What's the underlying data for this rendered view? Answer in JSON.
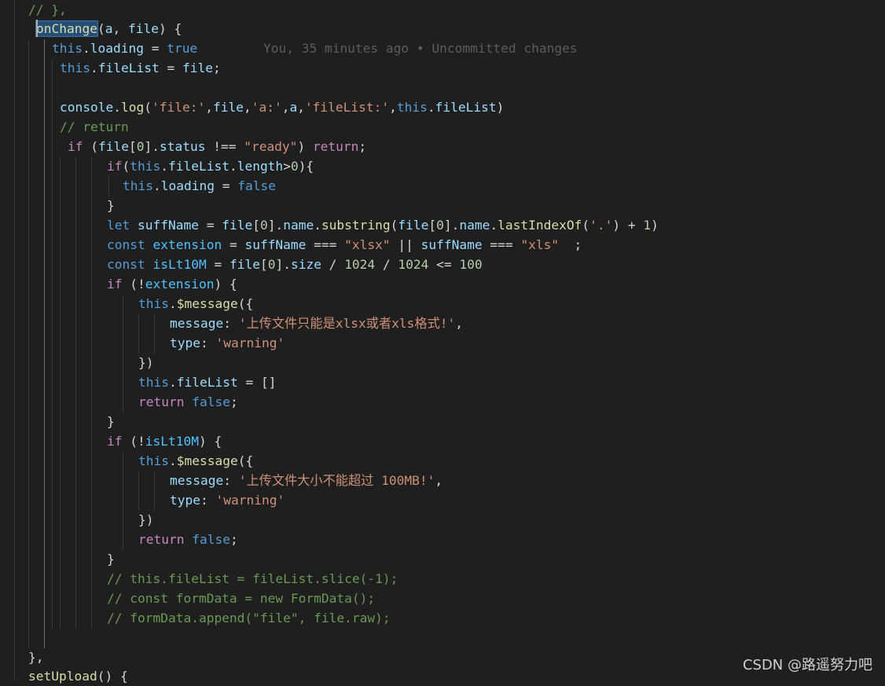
{
  "blame": "You, 35 minutes ago • Uncommitted changes",
  "watermark": "CSDN @路遥努力吧",
  "lines": [
    [
      [
        "cmt",
        "// },"
      ]
    ],
    [
      [
        "fn",
        "onChange"
      ],
      [
        "punc",
        "("
      ],
      [
        "var",
        "a"
      ],
      [
        "punc",
        ", "
      ],
      [
        "var",
        "file"
      ],
      [
        "punc",
        ") {"
      ]
    ],
    [
      [
        "kw",
        "this"
      ],
      [
        "punc",
        "."
      ],
      [
        "var",
        "loading"
      ],
      [
        "punc",
        " = "
      ],
      [
        "kw",
        "true"
      ]
    ],
    [
      [
        "kw",
        "this"
      ],
      [
        "punc",
        "."
      ],
      [
        "var",
        "fileList"
      ],
      [
        "punc",
        " = "
      ],
      [
        "var",
        "file"
      ],
      [
        "punc",
        ";"
      ]
    ],
    [],
    [
      [
        "var",
        "console"
      ],
      [
        "punc",
        "."
      ],
      [
        "fn",
        "log"
      ],
      [
        "punc",
        "("
      ],
      [
        "str",
        "'file:'"
      ],
      [
        "punc",
        ","
      ],
      [
        "var",
        "file"
      ],
      [
        "punc",
        ","
      ],
      [
        "str",
        "'a:'"
      ],
      [
        "punc",
        ","
      ],
      [
        "var",
        "a"
      ],
      [
        "punc",
        ","
      ],
      [
        "str",
        "'fileList:'"
      ],
      [
        "punc",
        ","
      ],
      [
        "kw",
        "this"
      ],
      [
        "punc",
        "."
      ],
      [
        "var",
        "fileList"
      ],
      [
        "punc",
        ")"
      ]
    ],
    [
      [
        "cmt",
        "// return"
      ]
    ],
    [
      [
        "ctl",
        "if"
      ],
      [
        "punc",
        " ("
      ],
      [
        "var",
        "file"
      ],
      [
        "punc",
        "["
      ],
      [
        "num",
        "0"
      ],
      [
        "punc",
        "]."
      ],
      [
        "var",
        "status"
      ],
      [
        "punc",
        " !== "
      ],
      [
        "str",
        "\"ready\""
      ],
      [
        "punc",
        ") "
      ],
      [
        "ctl",
        "return"
      ],
      [
        "punc",
        ";"
      ]
    ],
    [
      [
        "ctl",
        "if"
      ],
      [
        "punc",
        "("
      ],
      [
        "kw",
        "this"
      ],
      [
        "punc",
        "."
      ],
      [
        "var",
        "fileList"
      ],
      [
        "punc",
        "."
      ],
      [
        "var",
        "length"
      ],
      [
        "punc",
        ">"
      ],
      [
        "num",
        "0"
      ],
      [
        "punc",
        "){"
      ]
    ],
    [
      [
        "kw",
        "this"
      ],
      [
        "punc",
        "."
      ],
      [
        "var",
        "loading"
      ],
      [
        "punc",
        " = "
      ],
      [
        "kw",
        "false"
      ]
    ],
    [
      [
        "punc",
        "}"
      ]
    ],
    [
      [
        "kw",
        "let"
      ],
      [
        "punc",
        " "
      ],
      [
        "var",
        "suffName"
      ],
      [
        "punc",
        " = "
      ],
      [
        "var",
        "file"
      ],
      [
        "punc",
        "["
      ],
      [
        "num",
        "0"
      ],
      [
        "punc",
        "]."
      ],
      [
        "var",
        "name"
      ],
      [
        "punc",
        "."
      ],
      [
        "fn",
        "substring"
      ],
      [
        "punc",
        "("
      ],
      [
        "var",
        "file"
      ],
      [
        "punc",
        "["
      ],
      [
        "num",
        "0"
      ],
      [
        "punc",
        "]."
      ],
      [
        "var",
        "name"
      ],
      [
        "punc",
        "."
      ],
      [
        "fn",
        "lastIndexOf"
      ],
      [
        "punc",
        "("
      ],
      [
        "str",
        "'.'"
      ],
      [
        "punc",
        ") + "
      ],
      [
        "num",
        "1"
      ],
      [
        "punc",
        ")"
      ]
    ],
    [
      [
        "kw",
        "const"
      ],
      [
        "punc",
        " "
      ],
      [
        "cst",
        "extension"
      ],
      [
        "punc",
        " = "
      ],
      [
        "var",
        "suffName"
      ],
      [
        "punc",
        " === "
      ],
      [
        "str",
        "\"xlsx\""
      ],
      [
        "punc",
        " || "
      ],
      [
        "var",
        "suffName"
      ],
      [
        "punc",
        " === "
      ],
      [
        "str",
        "\"xls\""
      ],
      [
        "punc",
        "  ;"
      ]
    ],
    [
      [
        "kw",
        "const"
      ],
      [
        "punc",
        " "
      ],
      [
        "cst",
        "isLt10M"
      ],
      [
        "punc",
        " = "
      ],
      [
        "var",
        "file"
      ],
      [
        "punc",
        "["
      ],
      [
        "num",
        "0"
      ],
      [
        "punc",
        "]."
      ],
      [
        "var",
        "size"
      ],
      [
        "punc",
        " / "
      ],
      [
        "num",
        "1024"
      ],
      [
        "punc",
        " / "
      ],
      [
        "num",
        "1024"
      ],
      [
        "punc",
        " <= "
      ],
      [
        "num",
        "100"
      ]
    ],
    [
      [
        "ctl",
        "if"
      ],
      [
        "punc",
        " (!"
      ],
      [
        "cst",
        "extension"
      ],
      [
        "punc",
        ") {"
      ]
    ],
    [
      [
        "kw",
        "this"
      ],
      [
        "punc",
        "."
      ],
      [
        "fn",
        "$message"
      ],
      [
        "punc",
        "({"
      ]
    ],
    [
      [
        "var",
        "message"
      ],
      [
        "punc",
        ": "
      ],
      [
        "str",
        "'上传文件只能是xlsx或者xls格式!'"
      ],
      [
        "punc",
        ","
      ]
    ],
    [
      [
        "var",
        "type"
      ],
      [
        "punc",
        ": "
      ],
      [
        "str",
        "'warning'"
      ]
    ],
    [
      [
        "punc",
        "})"
      ]
    ],
    [
      [
        "kw",
        "this"
      ],
      [
        "punc",
        "."
      ],
      [
        "var",
        "fileList"
      ],
      [
        "punc",
        " = []"
      ]
    ],
    [
      [
        "ctl",
        "return"
      ],
      [
        "punc",
        " "
      ],
      [
        "kw",
        "false"
      ],
      [
        "punc",
        ";"
      ]
    ],
    [
      [
        "punc",
        "}"
      ]
    ],
    [
      [
        "ctl",
        "if"
      ],
      [
        "punc",
        " (!"
      ],
      [
        "cst",
        "isLt10M"
      ],
      [
        "punc",
        ") {"
      ]
    ],
    [
      [
        "kw",
        "this"
      ],
      [
        "punc",
        "."
      ],
      [
        "fn",
        "$message"
      ],
      [
        "punc",
        "({"
      ]
    ],
    [
      [
        "var",
        "message"
      ],
      [
        "punc",
        ": "
      ],
      [
        "str",
        "'上传文件大小不能超过 100MB!'"
      ],
      [
        "punc",
        ","
      ]
    ],
    [
      [
        "var",
        "type"
      ],
      [
        "punc",
        ": "
      ],
      [
        "str",
        "'warning'"
      ]
    ],
    [
      [
        "punc",
        "})"
      ]
    ],
    [
      [
        "ctl",
        "return"
      ],
      [
        "punc",
        " "
      ],
      [
        "kw",
        "false"
      ],
      [
        "punc",
        ";"
      ]
    ],
    [
      [
        "punc",
        "}"
      ]
    ],
    [
      [
        "cmt",
        "// this.fileList = fileList.slice(-1);"
      ]
    ],
    [
      [
        "cmt",
        "// const formData = new FormData();"
      ]
    ],
    [
      [
        "cmt",
        "// formData.append(\"file\", file.raw);"
      ]
    ],
    [],
    [],
    [
      [
        "punc",
        "},"
      ]
    ],
    [
      [
        "fn",
        "setUpload"
      ],
      [
        "punc",
        "() {"
      ]
    ]
  ]
}
